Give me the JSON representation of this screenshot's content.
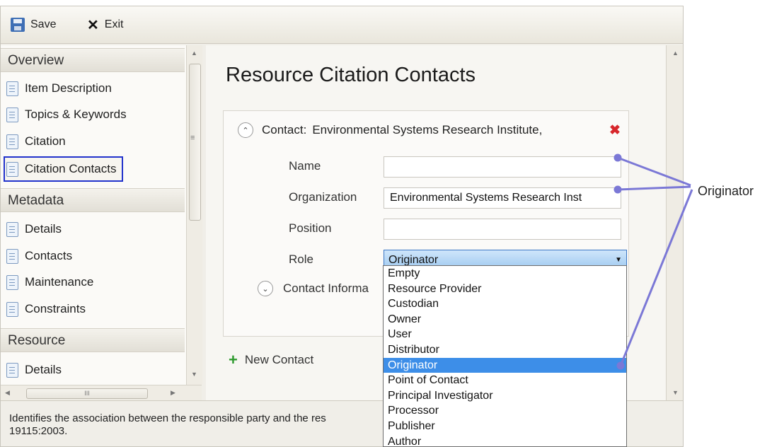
{
  "toolbar": {
    "save_label": "Save",
    "exit_label": "Exit"
  },
  "nav": {
    "sections": [
      {
        "title": "Overview",
        "items": [
          "Item Description",
          "Topics & Keywords",
          "Citation",
          "Citation Contacts"
        ]
      },
      {
        "title": "Metadata",
        "items": [
          "Details",
          "Contacts",
          "Maintenance",
          "Constraints"
        ]
      },
      {
        "title": "Resource",
        "items": [
          "Details"
        ]
      }
    ],
    "selected": "Citation Contacts"
  },
  "main": {
    "title": "Resource Citation Contacts",
    "contact": {
      "header_label": "Contact:",
      "header_value": "Environmental Systems Research Institute,",
      "fields": {
        "name_label": "Name",
        "name_value": "",
        "org_label": "Organization",
        "org_value": "Environmental Systems Research Inst",
        "position_label": "Position",
        "position_value": "",
        "role_label": "Role",
        "role_value": "Originator"
      },
      "contact_info_label": "Contact Informa"
    },
    "new_contact_label": "New Contact"
  },
  "role_options": [
    "Empty",
    "Resource Provider",
    "Custodian",
    "Owner",
    "User",
    "Distributor",
    "Originator",
    "Point of Contact",
    "Principal Investigator",
    "Processor",
    "Publisher",
    "Author"
  ],
  "role_highlighted": "Originator",
  "status": {
    "line1": "Identifies the association between the responsible party and the res",
    "line2": "19115:2003."
  },
  "callout": {
    "label": "Originator",
    "color": "#7b78d6"
  },
  "colors": {
    "selection_outline": "#2233cc",
    "highlight": "#3d8ee8",
    "delete": "#d7262b"
  }
}
